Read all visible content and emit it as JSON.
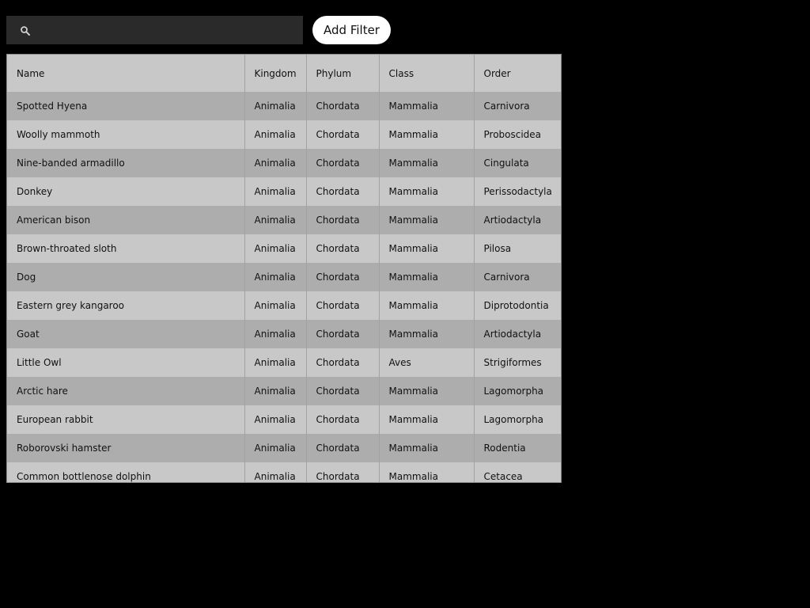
{
  "search": {
    "placeholder": "",
    "value": "",
    "icon": "search-icon"
  },
  "add_filter_label": "Add Filter",
  "table": {
    "columns": [
      "Name",
      "Kingdom",
      "Phylum",
      "Class",
      "Order"
    ],
    "rows": [
      [
        "Spotted Hyena",
        "Animalia",
        "Chordata",
        "Mammalia",
        "Carnivora"
      ],
      [
        "Woolly mammoth",
        "Animalia",
        "Chordata",
        "Mammalia",
        "Proboscidea"
      ],
      [
        "Nine-banded armadillo",
        "Animalia",
        "Chordata",
        "Mammalia",
        "Cingulata"
      ],
      [
        "Donkey",
        "Animalia",
        "Chordata",
        "Mammalia",
        "Perissodactyla"
      ],
      [
        "American bison",
        "Animalia",
        "Chordata",
        "Mammalia",
        "Artiodactyla"
      ],
      [
        "Brown-throated sloth",
        "Animalia",
        "Chordata",
        "Mammalia",
        "Pilosa"
      ],
      [
        "Dog",
        "Animalia",
        "Chordata",
        "Mammalia",
        "Carnivora"
      ],
      [
        "Eastern grey kangaroo",
        "Animalia",
        "Chordata",
        "Mammalia",
        "Diprotodontia"
      ],
      [
        "Goat",
        "Animalia",
        "Chordata",
        "Mammalia",
        "Artiodactyla"
      ],
      [
        "Little Owl",
        "Animalia",
        "Chordata",
        "Aves",
        "Strigiformes"
      ],
      [
        "Arctic hare",
        "Animalia",
        "Chordata",
        "Mammalia",
        "Lagomorpha"
      ],
      [
        "European rabbit",
        "Animalia",
        "Chordata",
        "Mammalia",
        "Lagomorpha"
      ],
      [
        "Roborovski hamster",
        "Animalia",
        "Chordata",
        "Mammalia",
        "Rodentia"
      ],
      [
        "Common bottlenose dolphin",
        "Animalia",
        "Chordata",
        "Mammalia",
        "Cetacea"
      ]
    ]
  },
  "colors": {
    "background": "#000000",
    "search_background": "#2a2a2a",
    "button_background": "#ffffff",
    "row_odd": "#adadad",
    "row_even": "#c8c8c8"
  }
}
